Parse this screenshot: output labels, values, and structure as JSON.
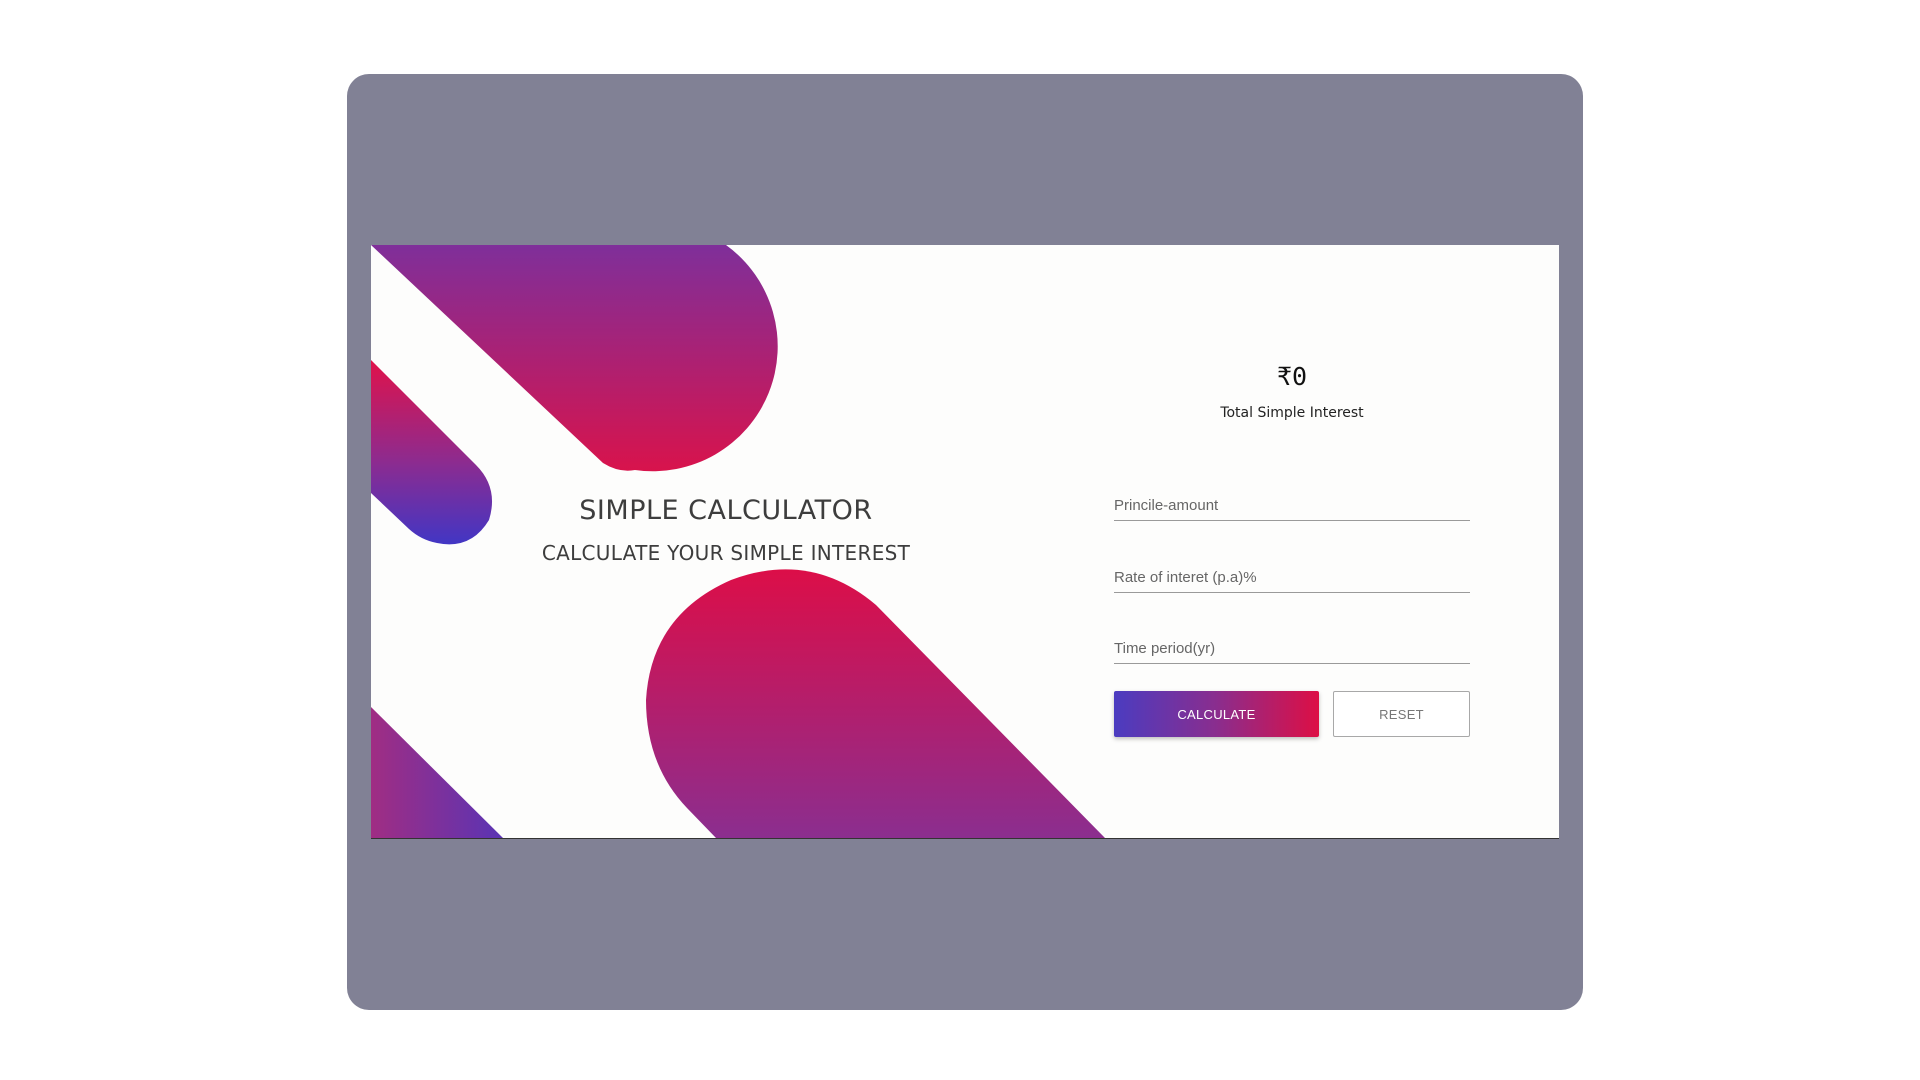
{
  "hero": {
    "title": "SIMPLE CALCULATOR",
    "subtitle": "CALCULATE YOUR SIMPLE INTEREST"
  },
  "result": {
    "value": "₹0",
    "label": "Total Simple Interest"
  },
  "form": {
    "principal_placeholder": "Princile-amount",
    "principal_value": "",
    "rate_placeholder": "Rate of interet (p.a)%",
    "rate_value": "",
    "time_placeholder": "Time period(yr)",
    "time_value": ""
  },
  "buttons": {
    "calculate_label": "CALCULATE",
    "reset_label": "RESET"
  },
  "colors": {
    "frame": "#818195",
    "gradient_blue": "#4b3cc0",
    "gradient_purple": "#8a2d8e",
    "gradient_red": "#dd0f45"
  }
}
